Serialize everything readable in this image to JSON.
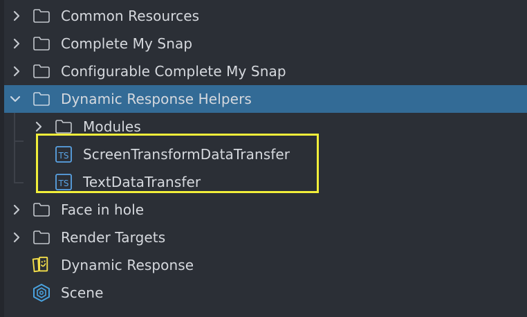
{
  "colors": {
    "background": "#2b2f36",
    "selected_row": "#336b96",
    "text": "#d6d9de",
    "icon_stroke": "#c4c8ce",
    "ts_icon": "#5aa4e6",
    "dynamic_response_icon": "#f5e04a",
    "scene_icon": "#4aa3e0",
    "highlight_border": "#f2ef3a"
  },
  "tree": {
    "items": [
      {
        "label": "Common Resources",
        "icon": "folder-icon",
        "expander": "chevron-right-icon"
      },
      {
        "label": "Complete My Snap",
        "icon": "folder-icon",
        "expander": "chevron-right-icon"
      },
      {
        "label": "Configurable Complete My Snap",
        "icon": "folder-icon",
        "expander": "chevron-right-icon"
      },
      {
        "label": "Dynamic Response Helpers",
        "icon": "folder-icon",
        "expander": "chevron-down-icon",
        "selected": true,
        "expanded": true
      },
      {
        "label": "Modules",
        "icon": "folder-icon",
        "expander": "chevron-right-icon",
        "depth": 1
      },
      {
        "label": "ScreenTransformDataTransfer",
        "icon": "typescript-file-icon",
        "depth": 1
      },
      {
        "label": "TextDataTransfer",
        "icon": "typescript-file-icon",
        "depth": 1
      },
      {
        "label": "Face in hole",
        "icon": "folder-icon",
        "expander": "chevron-right-icon"
      },
      {
        "label": "Render Targets",
        "icon": "folder-icon",
        "expander": "chevron-right-icon"
      },
      {
        "label": "Dynamic Response",
        "icon": "dynamic-response-icon"
      },
      {
        "label": "Scene",
        "icon": "scene-icon"
      }
    ],
    "ts_icon_text": "TS"
  }
}
